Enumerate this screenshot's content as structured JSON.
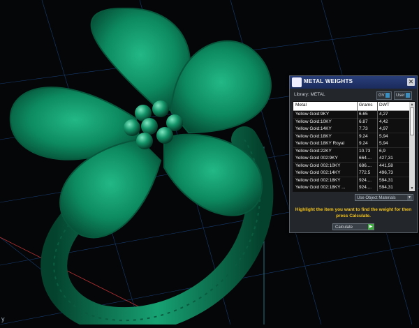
{
  "panel": {
    "title": "METAL WEIGHTS",
    "library_label": "Library: METAL",
    "tags": {
      "gv": "GV",
      "user": "User"
    },
    "close_glyph": "✕",
    "columns": [
      "Metal",
      "Grams",
      "DWT"
    ],
    "rows": [
      {
        "metal": "Yellow Gold:9KY",
        "grams": "6.65",
        "dwt": "4,27"
      },
      {
        "metal": "Yellow Gold:10KY",
        "grams": "6.87",
        "dwt": "4,42"
      },
      {
        "metal": "Yellow Gold:14KY",
        "grams": "7.73",
        "dwt": "4,97"
      },
      {
        "metal": "Yellow Gold:18KY",
        "grams": "9.24",
        "dwt": "5,94"
      },
      {
        "metal": "Yellow Gold:18KY Royal",
        "grams": "9.24",
        "dwt": "5,94"
      },
      {
        "metal": "Yellow Gold:22KY",
        "grams": "10.73",
        "dwt": "6,9"
      },
      {
        "metal": "Yellow Gold 002:9KY",
        "grams": "664....",
        "dwt": "427,31"
      },
      {
        "metal": "Yellow Gold 002:10KY",
        "grams": "686....",
        "dwt": "441,58"
      },
      {
        "metal": "Yellow Gold 002:14KY",
        "grams": "772.5",
        "dwt": "496,73"
      },
      {
        "metal": "Yellow Gold 002:18KY",
        "grams": "924....",
        "dwt": "594,31"
      },
      {
        "metal": "Yellow Gold 002:18KY ...",
        "grams": "924....",
        "dwt": "594,31"
      }
    ],
    "materials_button": "Use Object Materials",
    "instructions": "Highlight the item you want to find the weight for then press Calculate.",
    "calculate_select": "Calculate"
  },
  "viewport": {
    "axis_label": "y"
  },
  "colors": {
    "accent": "#f2c21a",
    "title_bar": "#1a2a5c",
    "model": "#0f8a62",
    "grid": "#1c4a8a"
  }
}
